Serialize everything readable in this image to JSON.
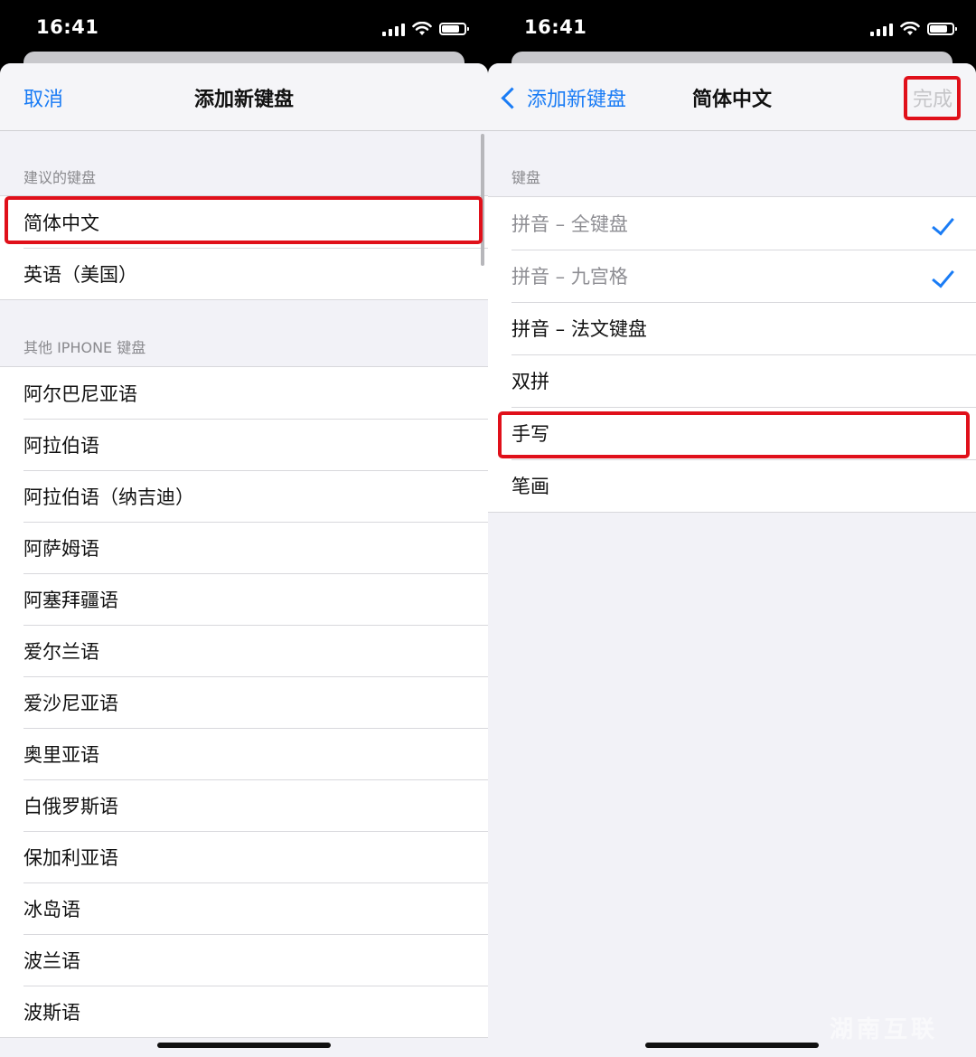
{
  "left": {
    "status": {
      "time": "16:41"
    },
    "nav": {
      "cancel": "取消",
      "title": "添加新键盘"
    },
    "suggested": {
      "header": "建议的键盘",
      "items": [
        "简体中文",
        "英语（美国）"
      ]
    },
    "other": {
      "header": "其他 IPHONE 键盘",
      "items": [
        "阿尔巴尼亚语",
        "阿拉伯语",
        "阿拉伯语（纳吉迪）",
        "阿萨姆语",
        "阿塞拜疆语",
        "爱尔兰语",
        "爱沙尼亚语",
        "奥里亚语",
        "白俄罗斯语",
        "保加利亚语",
        "冰岛语",
        "波兰语",
        "波斯语"
      ]
    }
  },
  "right": {
    "status": {
      "time": "16:41"
    },
    "nav": {
      "back": "添加新键盘",
      "title": "简体中文",
      "done": "完成"
    },
    "keyboards": {
      "header": "键盘",
      "items": [
        {
          "label": "拼音 – 全键盘",
          "checked": true,
          "dimmed": true
        },
        {
          "label": "拼音 – 九宫格",
          "checked": true,
          "dimmed": true
        },
        {
          "label": "拼音 – 法文键盘",
          "checked": false,
          "dimmed": false
        },
        {
          "label": "双拼",
          "checked": false,
          "dimmed": false
        },
        {
          "label": "手写",
          "checked": false,
          "dimmed": false
        },
        {
          "label": "笔画",
          "checked": false,
          "dimmed": false
        }
      ]
    }
  },
  "colors": {
    "accent": "#1a7cf5",
    "highlight": "#e0101a",
    "disabled": "#c5c5c8"
  },
  "watermark": "湖南互联"
}
